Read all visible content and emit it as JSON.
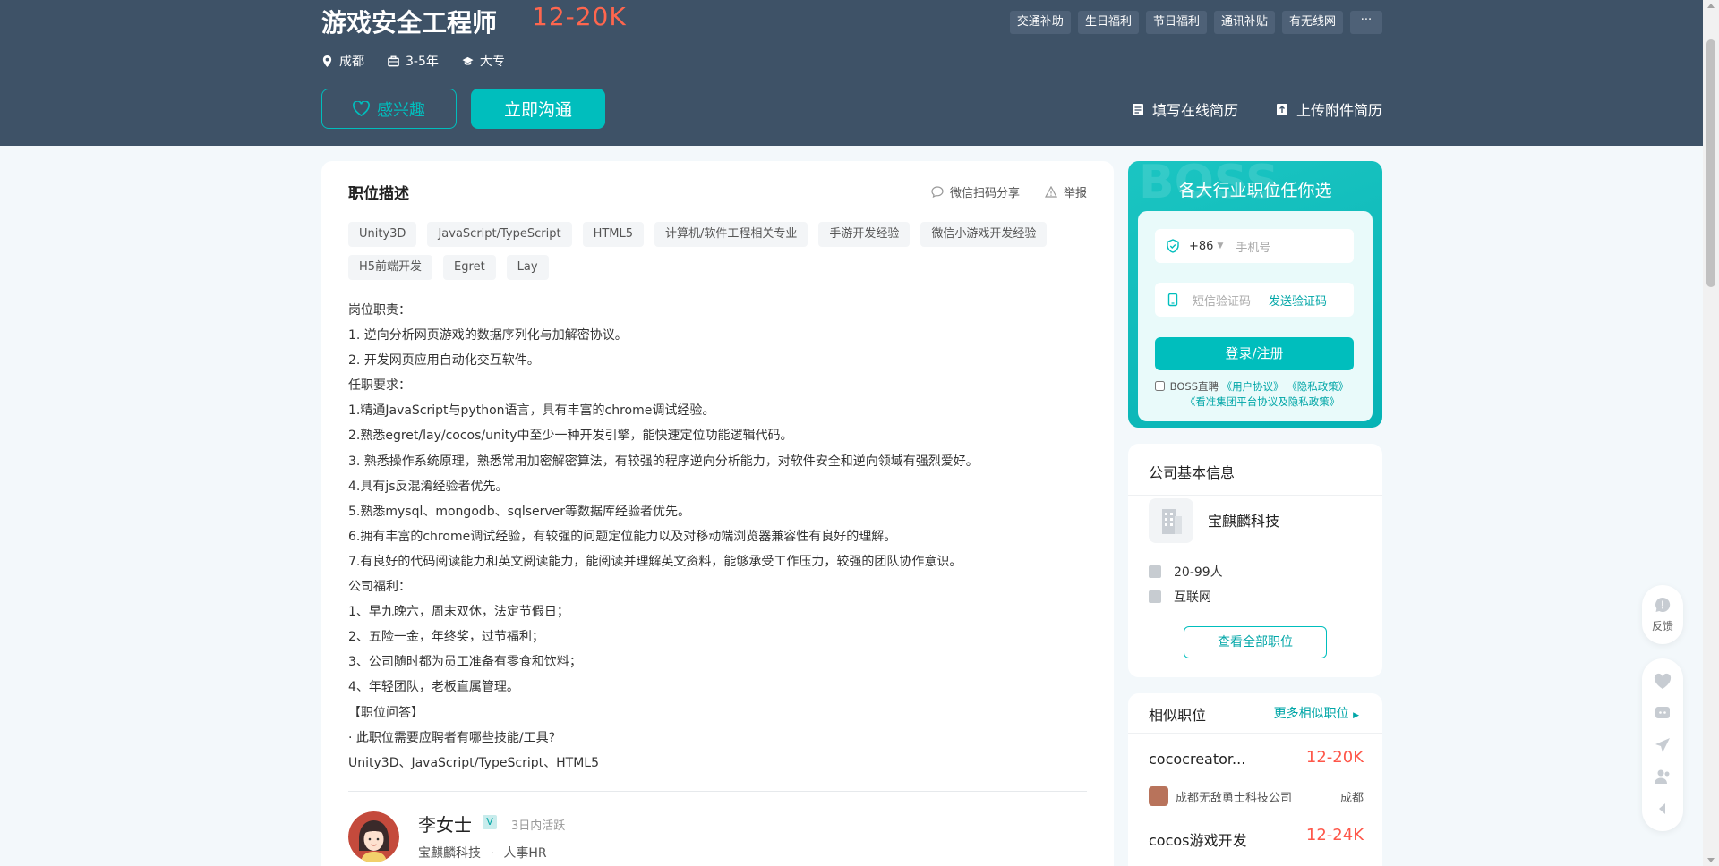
{
  "header": {
    "job_title": "游戏安全工程师",
    "salary": "12-20K",
    "benefits": [
      "交通补助",
      "生日福利",
      "节日福利",
      "通讯补贴",
      "有无线网"
    ],
    "more_label": "···",
    "city": "成都",
    "experience": "3-5年",
    "education": "大专",
    "interest_label": "感兴趣",
    "chat_label": "立即沟通",
    "online_resume_label": "填写在线简历",
    "upload_resume_label": "上传附件简历"
  },
  "job_detail": {
    "section_title": "职位描述",
    "share_label": "微信扫码分享",
    "report_label": "举报",
    "skill_tags": [
      "Unity3D",
      "JavaScript/TypeScript",
      "HTML5",
      "计算机/软件工程相关专业",
      "手游开发经验",
      "微信小游戏开发经验",
      "H5前端开发",
      "Egret",
      "Lay"
    ],
    "description_lines": [
      "岗位职责：",
      "1. 逆向分析网页游戏的数据序列化与加解密协议。",
      "2. 开发网页应用自动化交互软件。",
      "任职要求：",
      "1.精通JavaScript与python语言，具有丰富的chrome调试经验。",
      "2.熟悉egret/lay/cocos/unity中至少一种开发引擎，能快速定位功能逻辑代码。",
      "3. 熟悉操作系统原理，熟悉常用加密解密算法，有较强的程序逆向分析能力，对软件安全和逆向领域有强烈爱好。",
      "4.具有js反混淆经验者优先。",
      "5.熟悉mysql、mongodb、sqlserver等数据库经验者优先。",
      "6.拥有丰富的chrome调试经验，有较强的问题定位能力以及对移动端浏览器兼容性有良好的理解。",
      "7.有良好的代码阅读能力和英文阅读能力，能阅读并理解英文资料，能够承受工作压力，较强的团队协作意识。",
      "公司福利：",
      "1、早九晚六，周末双休，法定节假日；",
      "2、五险一金，年终奖，过节福利；",
      "3、公司随时都为员工准备有零食和饮料；",
      "4、年轻团队，老板直属管理。",
      "【职位问答】",
      "· 此职位需要应聘者有哪些技能/工具?",
      "Unity3D、JavaScript/TypeScript、HTML5"
    ]
  },
  "recruiter": {
    "name": "李女士",
    "verified_mark": "V",
    "active_status": "3日内活跃",
    "company": "宝麒麟科技",
    "separator": "·",
    "role": "人事HR"
  },
  "login_panel": {
    "watermark": "BOSS",
    "title": "各大行业职位任你选",
    "country_code": "+86",
    "phone_placeholder": "手机号",
    "code_placeholder": "短信验证码",
    "send_code_label": "发送验证码",
    "login_label": "登录/注册",
    "agree_prefix": "BOSS直聘",
    "user_agreement": "《用户协议》",
    "privacy_policy": "《隐私政策》",
    "group_policy": "《看准集团平台协议及隐私政策》"
  },
  "company_info": {
    "title": "公司基本信息",
    "name": "宝麒麟科技",
    "size": "20-99人",
    "industry": "互联网",
    "all_jobs_label": "查看全部职位"
  },
  "similar_jobs": {
    "title": "相似职位",
    "more_label": "更多相似职位",
    "items": [
      {
        "name": "cococreator...",
        "salary": "12-20K",
        "company": "成都无敌勇士科技公司",
        "city": "成都"
      },
      {
        "name": "cocos游戏开发",
        "salary": "12-24K"
      }
    ]
  },
  "floating_toolbar": {
    "feedback_label": "反馈"
  },
  "colors": {
    "banner": "#3e5267",
    "accent": "#00bebd",
    "salary": "#fe664e"
  }
}
